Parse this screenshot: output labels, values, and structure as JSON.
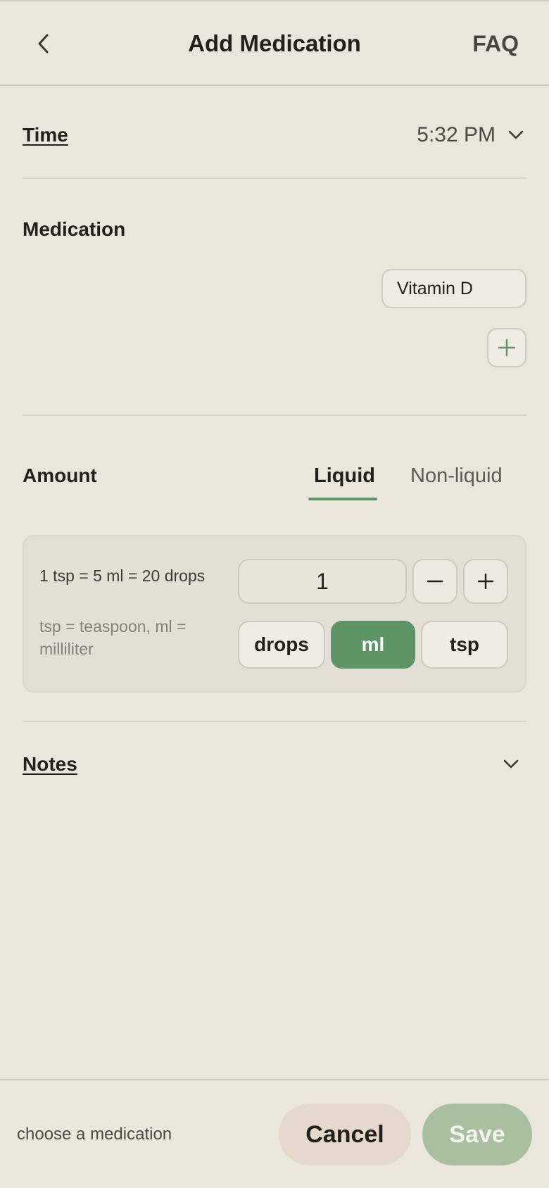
{
  "header": {
    "title": "Add Medication",
    "faq_label": "FAQ"
  },
  "time": {
    "label": "Time",
    "value": "5:32 PM"
  },
  "medication": {
    "label": "Medication",
    "selected": "Vitamin D",
    "add_icon": "plus-icon"
  },
  "amount": {
    "label": "Amount",
    "tabs": [
      {
        "label": "Liquid",
        "active": true
      },
      {
        "label": "Non-liquid",
        "active": false
      }
    ],
    "conversion_main": "1 tsp = 5 ml = 20 drops",
    "conversion_sub": "tsp = teaspoon, ml = milliliter",
    "quantity": "1",
    "units": [
      {
        "label": "drops",
        "selected": false
      },
      {
        "label": "ml",
        "selected": true
      },
      {
        "label": "tsp",
        "selected": false
      }
    ]
  },
  "notes": {
    "label": "Notes"
  },
  "footer": {
    "hint": "choose a medication",
    "cancel_label": "Cancel",
    "save_label": "Save"
  },
  "colors": {
    "background": "#EAE6DB",
    "accent": "#5E9566",
    "save_disabled": "#A8BFA0",
    "cancel_bg": "#E5D9CE"
  }
}
